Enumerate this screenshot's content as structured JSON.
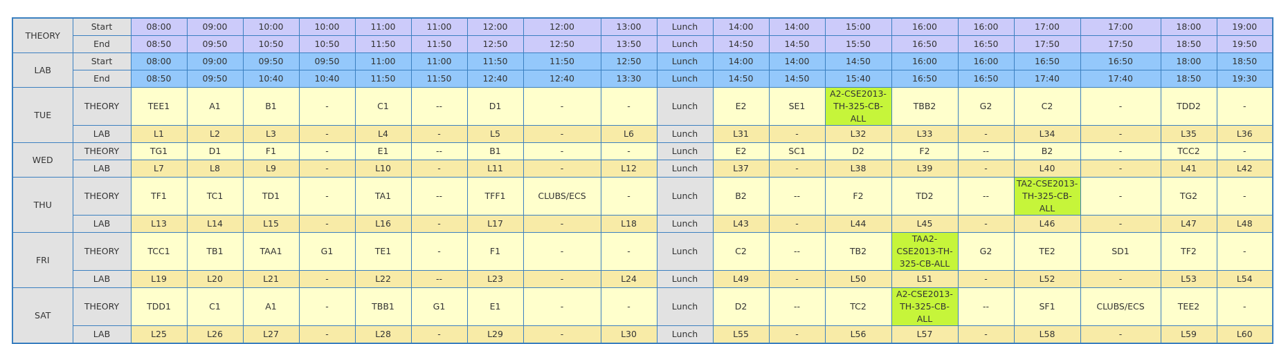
{
  "timetable": {
    "theory_header": {
      "label": "THEORY",
      "start_label": "Start",
      "end_label": "End",
      "start": [
        "08:00",
        "09:00",
        "10:00",
        "10:00",
        "11:00",
        "11:00",
        "12:00",
        "12:00",
        "13:00",
        "Lunch",
        "14:00",
        "14:00",
        "15:00",
        "16:00",
        "16:00",
        "17:00",
        "17:00",
        "18:00",
        "19:00"
      ],
      "end": [
        "08:50",
        "09:50",
        "10:50",
        "10:50",
        "11:50",
        "11:50",
        "12:50",
        "12:50",
        "13:50",
        "Lunch",
        "14:50",
        "14:50",
        "15:50",
        "16:50",
        "16:50",
        "17:50",
        "17:50",
        "18:50",
        "19:50"
      ]
    },
    "lab_header": {
      "label": "LAB",
      "start_label": "Start",
      "end_label": "End",
      "start": [
        "08:00",
        "09:00",
        "09:50",
        "09:50",
        "11:00",
        "11:00",
        "11:50",
        "11:50",
        "12:50",
        "Lunch",
        "14:00",
        "14:00",
        "14:50",
        "16:00",
        "16:00",
        "16:50",
        "16:50",
        "18:00",
        "18:50"
      ],
      "end": [
        "08:50",
        "09:50",
        "10:40",
        "10:40",
        "11:50",
        "11:50",
        "12:40",
        "12:40",
        "13:30",
        "Lunch",
        "14:50",
        "14:50",
        "15:40",
        "16:50",
        "16:50",
        "17:40",
        "17:40",
        "18:50",
        "19:30"
      ]
    },
    "theory_row_label": "THEORY",
    "lab_row_label": "LAB",
    "days": [
      {
        "name": "TUE",
        "theory": [
          "TEE1",
          "A1",
          "B1",
          "-",
          "C1",
          "--",
          "D1",
          "-",
          "-",
          "Lunch",
          "E2",
          "SE1",
          "A2-CSE2013-TH-325-CB-ALL",
          "TBB2",
          "G2",
          "C2",
          "-",
          "TDD2",
          "-"
        ],
        "lab": [
          "L1",
          "L2",
          "L3",
          "-",
          "L4",
          "-",
          "L5",
          "-",
          "L6",
          "Lunch",
          "L31",
          "-",
          "L32",
          "L33",
          "-",
          "L34",
          "-",
          "L35",
          "L36"
        ]
      },
      {
        "name": "WED",
        "theory": [
          "TG1",
          "D1",
          "F1",
          "-",
          "E1",
          "--",
          "B1",
          "-",
          "-",
          "Lunch",
          "E2",
          "SC1",
          "D2",
          "F2",
          "--",
          "B2",
          "-",
          "TCC2",
          "-"
        ],
        "lab": [
          "L7",
          "L8",
          "L9",
          "-",
          "L10",
          "-",
          "L11",
          "-",
          "L12",
          "Lunch",
          "L37",
          "-",
          "L38",
          "L39",
          "-",
          "L40",
          "-",
          "L41",
          "L42"
        ]
      },
      {
        "name": "THU",
        "theory": [
          "TF1",
          "TC1",
          "TD1",
          "-",
          "TA1",
          "--",
          "TFF1",
          "CLUBS/ECS",
          "-",
          "Lunch",
          "B2",
          "--",
          "F2",
          "TD2",
          "--",
          "TA2-CSE2013-TH-325-CB-ALL",
          "-",
          "TG2",
          "-"
        ],
        "lab": [
          "L13",
          "L14",
          "L15",
          "-",
          "L16",
          "-",
          "L17",
          "-",
          "L18",
          "Lunch",
          "L43",
          "-",
          "L44",
          "L45",
          "-",
          "L46",
          "-",
          "L47",
          "L48"
        ]
      },
      {
        "name": "FRI",
        "theory": [
          "TCC1",
          "TB1",
          "TAA1",
          "G1",
          "TE1",
          "-",
          "F1",
          "-",
          "-",
          "Lunch",
          "C2",
          "--",
          "TB2",
          "TAA2-CSE2013-TH-325-CB-ALL",
          "G2",
          "TE2",
          "SD1",
          "TF2",
          "-"
        ],
        "lab": [
          "L19",
          "L20",
          "L21",
          "-",
          "L22",
          "--",
          "L23",
          "-",
          "L24",
          "Lunch",
          "L49",
          "-",
          "L50",
          "L51",
          "-",
          "L52",
          "-",
          "L53",
          "L54"
        ]
      },
      {
        "name": "SAT",
        "theory": [
          "TDD1",
          "C1",
          "A1",
          "-",
          "TBB1",
          "G1",
          "E1",
          "-",
          "-",
          "Lunch",
          "D2",
          "--",
          "TC2",
          "A2-CSE2013-TH-325-CB-ALL",
          "--",
          "SF1",
          "CLUBS/ECS",
          "TEE2",
          "-"
        ],
        "lab": [
          "L25",
          "L26",
          "L27",
          "-",
          "L28",
          "-",
          "L29",
          "-",
          "L30",
          "Lunch",
          "L55",
          "-",
          "L56",
          "L57",
          "-",
          "L58",
          "-",
          "L59",
          "L60"
        ]
      }
    ],
    "colors": {
      "theory_header": "#cccbfa",
      "lab_header": "#94c8fb",
      "theory_body": "#ffffcc",
      "lab_body": "#f8eba7",
      "label_gray": "#e2e2e2",
      "highlight": "#c6f53a",
      "border": "#3a7fc0"
    }
  }
}
